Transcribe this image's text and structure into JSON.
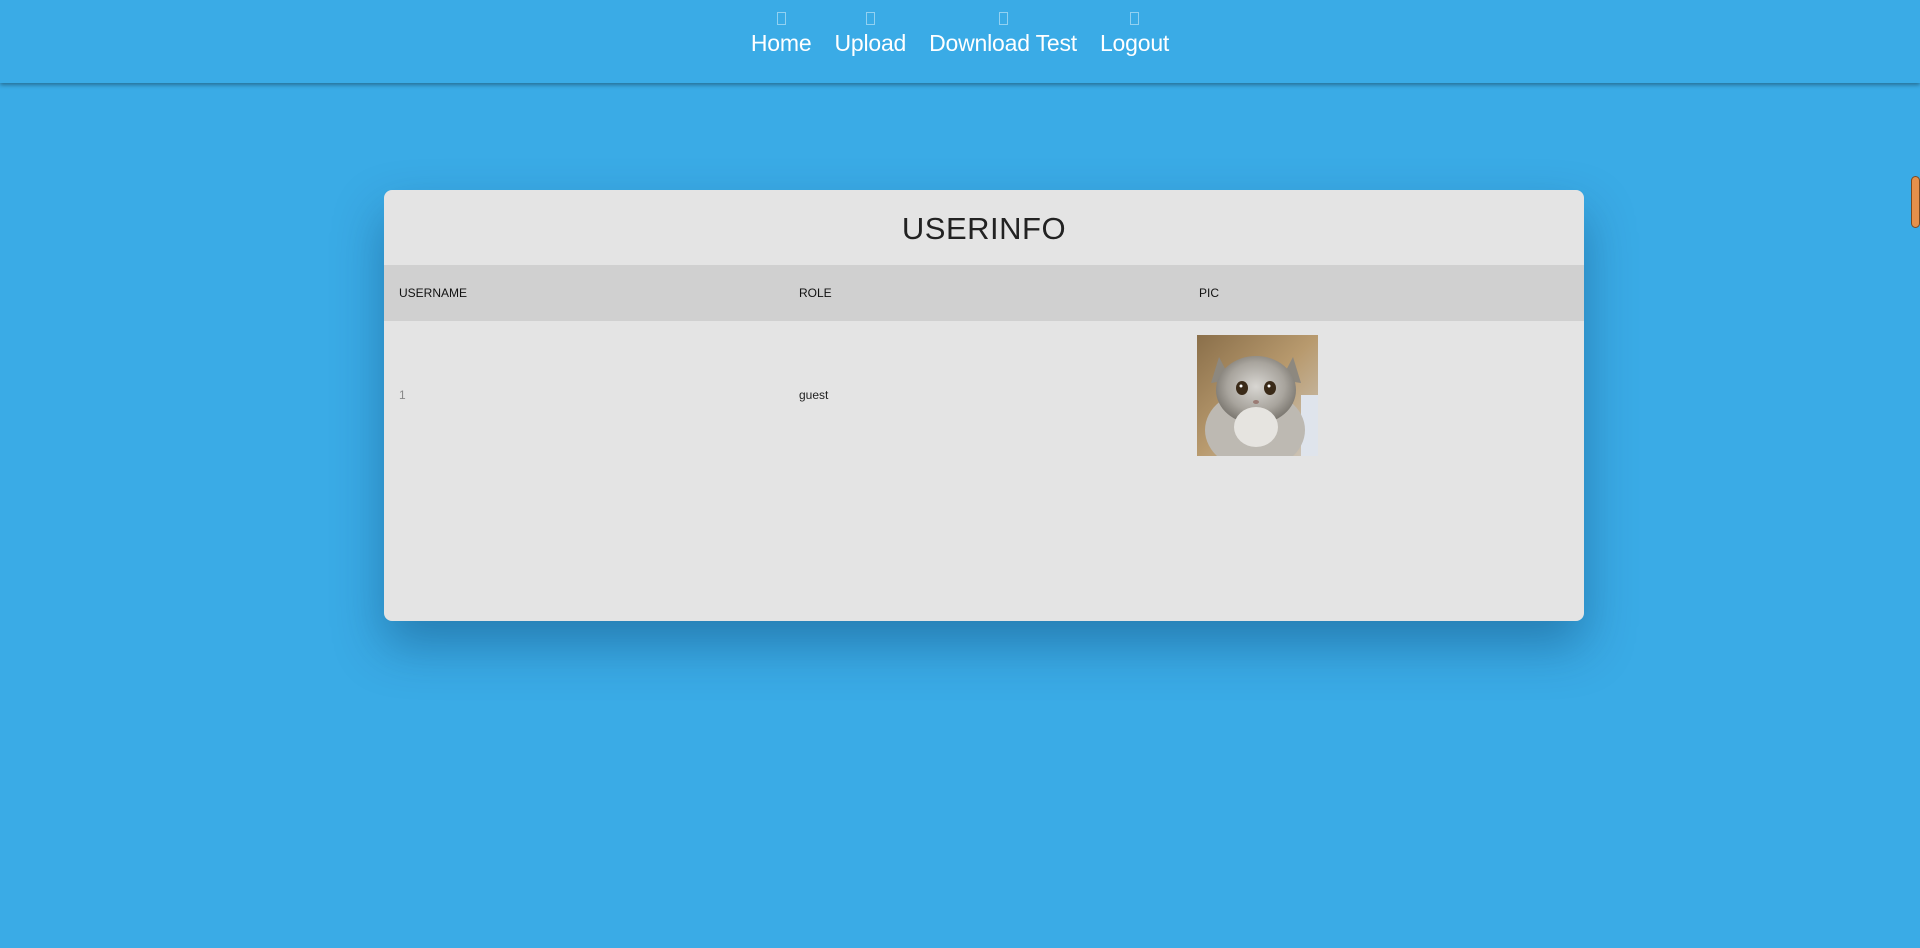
{
  "nav": {
    "items": [
      {
        "label": "Home",
        "icon": "home-icon"
      },
      {
        "label": "Upload",
        "icon": "upload-icon"
      },
      {
        "label": "Download Test",
        "icon": "download-icon"
      },
      {
        "label": "Logout",
        "icon": "logout-icon"
      }
    ]
  },
  "card": {
    "title": "USERINFO",
    "columns": [
      "USERNAME",
      "ROLE",
      "PIC"
    ],
    "rows": [
      {
        "username": "1",
        "role": "guest",
        "pic": "cat-photo"
      }
    ]
  },
  "colors": {
    "background": "#3aabe6",
    "card": "#e4e4e4",
    "header_row": "#d0d0d0",
    "scrollbar_thumb": "#e5904a"
  }
}
